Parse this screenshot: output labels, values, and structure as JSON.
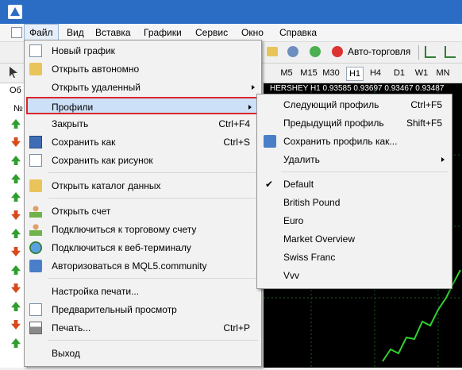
{
  "menubar": {
    "items": [
      "Файл",
      "Вид",
      "Вставка",
      "Графики",
      "Сервис",
      "Окно",
      "Справка"
    ]
  },
  "toolbar": {
    "autotrading_label": "Авто-торговля"
  },
  "timeframes": [
    "M5",
    "M15",
    "M30",
    "H1",
    "H4",
    "D1",
    "W1",
    "MN"
  ],
  "left_panel": {
    "title": "Об",
    "column": "№"
  },
  "chart": {
    "header": "HERSHEY H1 0.93585 0.93697 0.93467 0.93487"
  },
  "file_menu": {
    "items": [
      {
        "label": "Новый график",
        "shortcut": ""
      },
      {
        "label": "Открыть автономно",
        "shortcut": ""
      },
      {
        "label": "Открыть удаленный",
        "shortcut": ""
      },
      {
        "label": "Профили",
        "shortcut": ""
      },
      {
        "label": "Закрыть",
        "shortcut": "Ctrl+F4"
      },
      {
        "label": "Сохранить как",
        "shortcut": "Ctrl+S"
      },
      {
        "label": "Сохранить как рисунок",
        "shortcut": ""
      },
      {
        "label": "Открыть каталог данных",
        "shortcut": ""
      },
      {
        "label": "Открыть счет",
        "shortcut": ""
      },
      {
        "label": "Подключиться к торговому счету",
        "shortcut": ""
      },
      {
        "label": "Подключиться к веб-терминалу",
        "shortcut": ""
      },
      {
        "label": "Авторизоваться в MQL5.community",
        "shortcut": ""
      },
      {
        "label": "Настройка печати...",
        "shortcut": ""
      },
      {
        "label": "Предварительный просмотр",
        "shortcut": ""
      },
      {
        "label": "Печать...",
        "shortcut": "Ctrl+P"
      },
      {
        "label": "Выход",
        "shortcut": ""
      }
    ]
  },
  "profiles_menu": {
    "items": [
      {
        "label": "Следующий профиль",
        "shortcut": "Ctrl+F5"
      },
      {
        "label": "Предыдущий профиль",
        "shortcut": "Shift+F5"
      },
      {
        "label": "Сохранить профиль как...",
        "shortcut": ""
      },
      {
        "label": "Удалить",
        "shortcut": ""
      },
      {
        "label": "Default",
        "shortcut": "",
        "checked": "✔"
      },
      {
        "label": "British Pound",
        "shortcut": ""
      },
      {
        "label": "Euro",
        "shortcut": ""
      },
      {
        "label": "Market Overview",
        "shortcut": ""
      },
      {
        "label": "Swiss Franc",
        "shortcut": ""
      },
      {
        "label": "Vvv",
        "shortcut": ""
      }
    ]
  },
  "colors": {
    "highlight": "#cce0f7",
    "highlight_border": "#d9262b",
    "titlebar": "#2b6cc4"
  }
}
